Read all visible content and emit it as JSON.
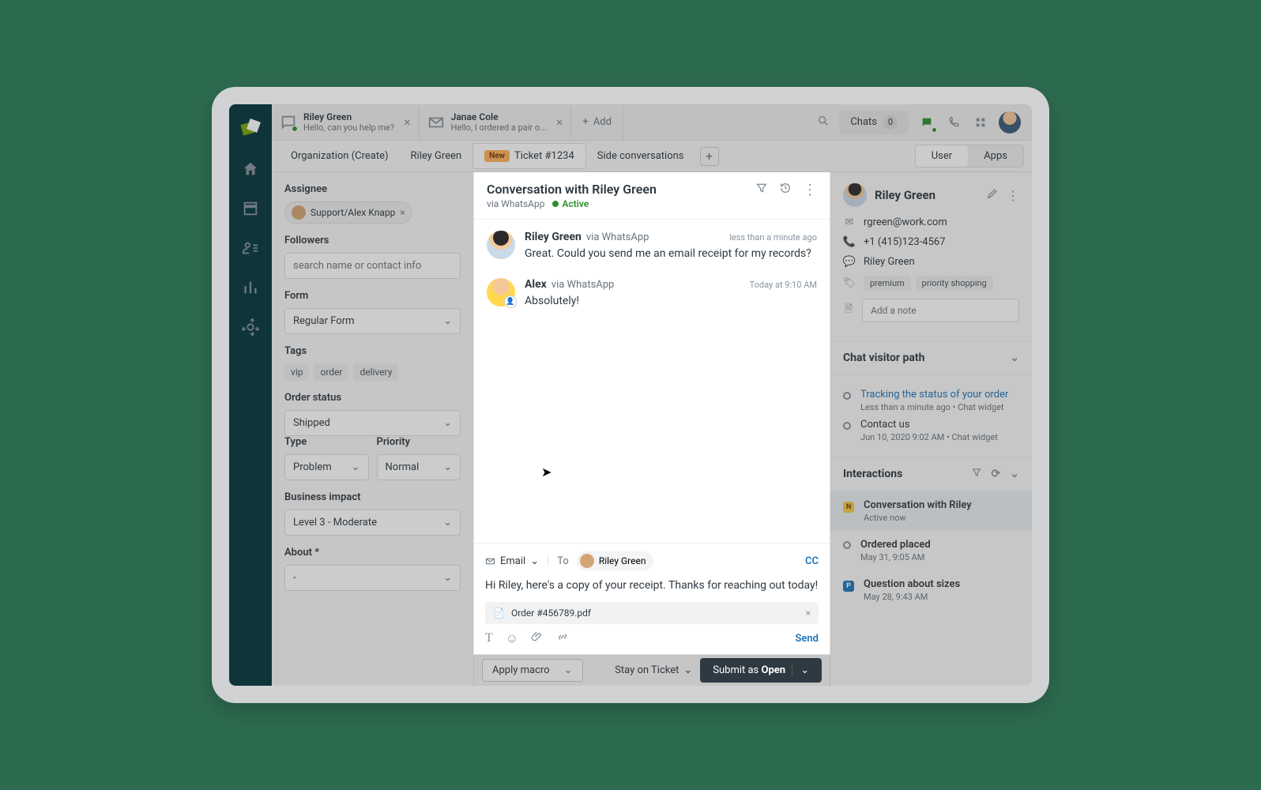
{
  "topTabs": [
    {
      "name": "Riley Green",
      "preview": "Hello, can you help me?",
      "iconDot": true
    },
    {
      "name": "Janae Cole",
      "preview": "Hello, I ordered a pair o...",
      "iconDot": false
    }
  ],
  "addLabel": "Add",
  "chatsLabel": "Chats",
  "chatsCount": "0",
  "subTabs": {
    "org": "Organization (Create)",
    "user": "Riley Green",
    "newBadge": "New",
    "ticket": "Ticket #1234",
    "side": "Side conversations",
    "right": [
      "User",
      "Apps"
    ]
  },
  "leftPanel": {
    "assigneeLabel": "Assignee",
    "assignee": "Support/Alex Knapp",
    "followersLabel": "Followers",
    "followersPlaceholder": "search name or contact info",
    "formLabel": "Form",
    "formValue": "Regular Form",
    "tagsLabel": "Tags",
    "tags": [
      "vip",
      "order",
      "delivery"
    ],
    "orderStatusLabel": "Order status",
    "orderStatusValue": "Shipped",
    "typeLabel": "Type",
    "typeValue": "Problem",
    "priorityLabel": "Priority",
    "priorityValue": "Normal",
    "businessImpactLabel": "Business impact",
    "businessImpactValue": "Level 3 - Moderate",
    "aboutLabel": "About *",
    "aboutValue": "-"
  },
  "conversation": {
    "title": "Conversation with Riley Green",
    "via": "via WhatsApp",
    "status": "Active",
    "messages": [
      {
        "author": "Riley Green",
        "via": "via WhatsApp",
        "time": "less than a minute ago",
        "text": "Great. Could you send me an email receipt for my records?",
        "avatarClass": ""
      },
      {
        "author": "Alex",
        "via": "via WhatsApp",
        "time": "Today at 9:10 AM",
        "text": "Absolutely!",
        "avatarClass": "alex",
        "agentBadge": true
      }
    ],
    "composer": {
      "channel": "Email",
      "toLabel": "To",
      "toName": "Riley Green",
      "cc": "CC",
      "body": "Hi Riley, here's a copy of your receipt. Thanks for reaching out today!",
      "attachment": "Order #456789.pdf",
      "send": "Send"
    }
  },
  "bottomBar": {
    "macro": "Apply macro",
    "stay": "Stay on Ticket",
    "submitPrefix": "Submit as ",
    "submitStatus": "Open"
  },
  "rightPanel": {
    "userName": "Riley Green",
    "email": "rgreen@work.com",
    "phone": "+1 (415)123-4567",
    "whatsapp": "Riley Green",
    "tags": [
      "premium",
      "priority shopping"
    ],
    "notePlaceholder": "Add a note",
    "chatVisitorLabel": "Chat visitor path",
    "path": [
      {
        "title": "Tracking the status of your order",
        "sub": "Less than a minute ago • Chat widget",
        "link": true
      },
      {
        "title": "Contact us",
        "sub": "Jun 10, 2020 9:02 AM • Chat widget",
        "link": false
      }
    ],
    "interactionsLabel": "Interactions",
    "interactions": [
      {
        "badge": "N",
        "badgeClass": "ib-n",
        "title": "Conversation with Riley",
        "sub": "Active now",
        "active": true
      },
      {
        "badge": "",
        "badgeClass": "ib-o",
        "title": "Ordered placed",
        "sub": "May 31, 9:05 AM"
      },
      {
        "badge": "P",
        "badgeClass": "ib-p",
        "title": "Question about sizes",
        "sub": "May 28, 9:43 AM"
      }
    ]
  }
}
